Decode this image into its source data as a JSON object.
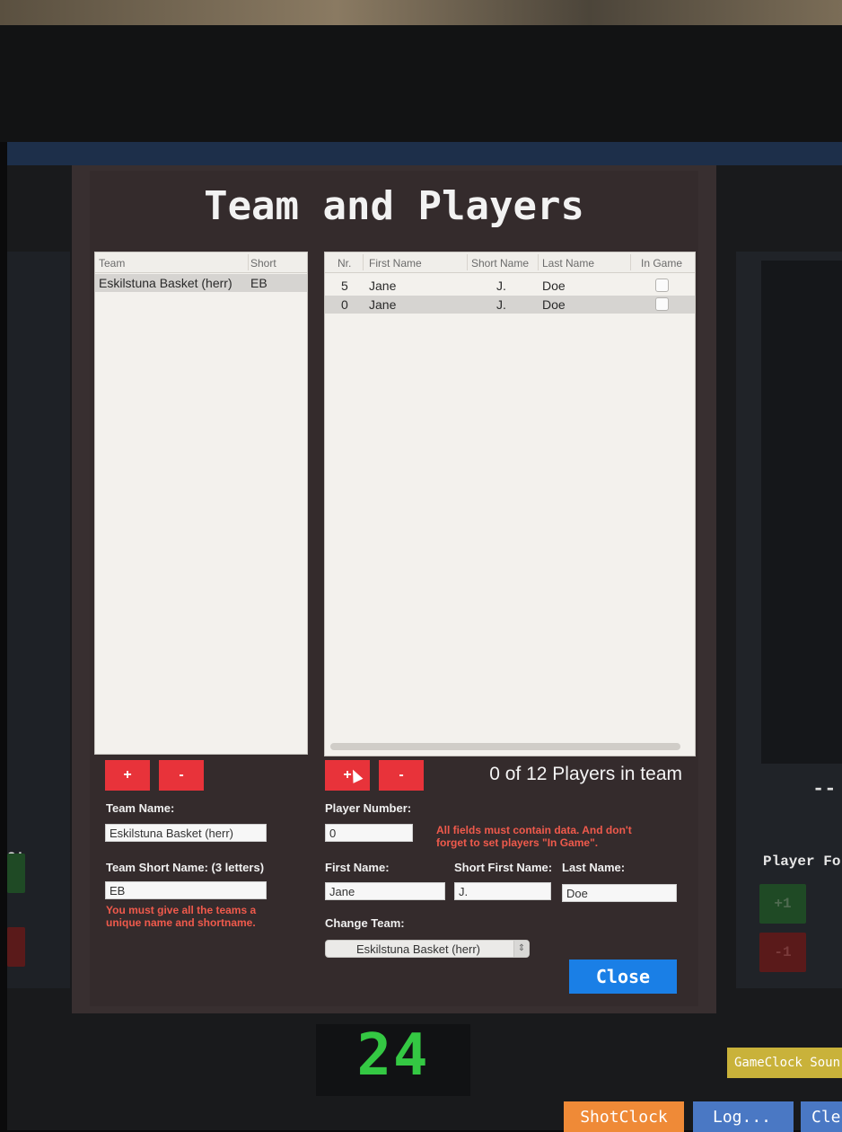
{
  "background": {
    "left_label": "s:",
    "right_dash": "--",
    "player_fo_label": "Player Fo",
    "plus_label": "+1",
    "minus_label": "-1",
    "shot_clock_value": "24",
    "buttons": {
      "gameclock_sound": "GameClock Soun",
      "shotclock": "ShotClock",
      "log": "Log...",
      "cle": "Cle"
    }
  },
  "dialog": {
    "title": "Team and Players",
    "team_table": {
      "columns": [
        "Team",
        "Short"
      ],
      "rows": [
        {
          "team": "Eskilstuna Basket (herr)",
          "short": "EB"
        }
      ]
    },
    "player_table": {
      "columns": [
        "Nr.",
        "First Name",
        "Short Name",
        "Last Name",
        "In Game"
      ],
      "rows": [
        {
          "nr": "5",
          "first": "Jane",
          "short": "J.",
          "last": "Doe",
          "in_game": false
        },
        {
          "nr": "0",
          "first": "Jane",
          "short": "J.",
          "last": "Doe",
          "in_game": false
        }
      ]
    },
    "team_add": "+",
    "team_remove": "-",
    "player_add": "+",
    "player_remove": "-",
    "players_count": "0 of 12 Players in team",
    "team_name_label": "Team Name:",
    "team_name_value": "Eskilstuna Basket (herr)",
    "team_short_label": "Team Short Name: (3 letters)",
    "team_short_value": "EB",
    "team_warning": "You must give all the teams a unique name and shortname.",
    "player_number_label": "Player Number:",
    "player_number_value": "0",
    "player_warning": "All fields must contain data. And don't forget to set players \"In Game\".",
    "first_name_label": "First Name:",
    "first_name_value": "Jane",
    "short_first_label": "Short First Name:",
    "short_first_value": "J.",
    "last_name_label": "Last Name:",
    "last_name_value": "Doe",
    "change_team_label": "Change Team:",
    "change_team_value": "Eskilstuna Basket (herr)",
    "close_label": "Close"
  }
}
